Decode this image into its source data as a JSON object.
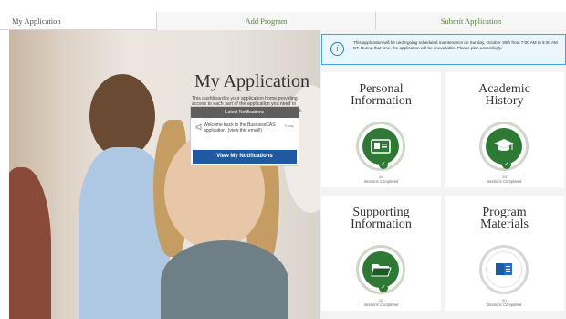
{
  "tabs": [
    {
      "label": "My Application",
      "active": true
    },
    {
      "label": "Add Program",
      "active": false
    },
    {
      "label": "Submit Application",
      "active": false
    }
  ],
  "hero": {
    "title": "My Application",
    "description": "This dashboard is your application home providing access to each part of the application you need to complete and a high level overview of your progress."
  },
  "notifications": {
    "header": "Latest Notifications",
    "message": "Welcome back to the BusinessCAS application. (view this email!)",
    "date": "Today",
    "button_label": "View My Notifications"
  },
  "alert": {
    "text": "This application will be undergoing scheduled maintenance on Sunday, October 30th from 7:00 AM to 9:30 AM ET. During that time, the application will be unavailable. Please plan accordingly."
  },
  "cards": [
    {
      "title_line1": "Personal",
      "title_line2": "Information",
      "fraction": "4/4",
      "sections_label": "Sections Completed",
      "icon": "id-card-icon",
      "complete": true
    },
    {
      "title_line1": "Academic",
      "title_line2": "History",
      "fraction": "3/3",
      "sections_label": "Sections Completed",
      "icon": "graduation-cap-icon",
      "complete": true
    },
    {
      "title_line1": "Supporting",
      "title_line2": "Information",
      "fraction": "2/2",
      "sections_label": "Sections Completed",
      "icon": "folder-icon",
      "complete": true
    },
    {
      "title_line1": "Program",
      "title_line2": "Materials",
      "fraction": "0/1",
      "sections_label": "Sections Completed",
      "icon": "book-icon",
      "complete": false
    }
  ],
  "colors": {
    "tab_link": "#5a7f3a",
    "complete_green": "#2e7a35",
    "button_blue": "#1f5aa0",
    "alert_border": "#3fa6d6"
  }
}
